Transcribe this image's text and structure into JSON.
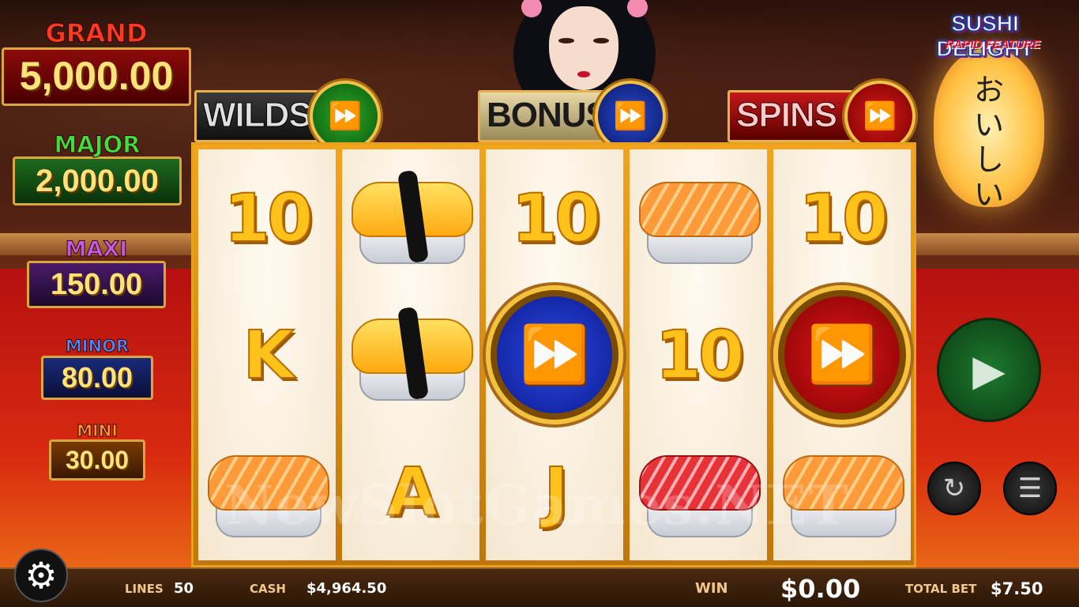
{
  "logo": {
    "title": "SUSHI DELIGHT",
    "subtitle": "RAPID FEATURE"
  },
  "jackpots": {
    "grand": {
      "label": "GRAND",
      "value": "5,000.00"
    },
    "major": {
      "label": "MAJOR",
      "value": "2,000.00"
    },
    "maxi": {
      "label": "MAXI",
      "value": "150.00"
    },
    "minor": {
      "label": "MINOR",
      "value": "80.00"
    },
    "mini": {
      "label": "MINI",
      "value": "30.00"
    }
  },
  "features": {
    "wilds": {
      "label": "WILDS"
    },
    "bonus": {
      "label": "BONUS"
    },
    "spins": {
      "label": "SPINS"
    }
  },
  "icons": {
    "fast_forward": "⏩",
    "spin": "▶",
    "autoplay": "↻",
    "coins": "☰",
    "settings": "⚙"
  },
  "reels": [
    [
      {
        "type": "number",
        "text": "10"
      },
      {
        "type": "letter",
        "text": "K"
      },
      {
        "type": "sushi",
        "variant": "salmon"
      }
    ],
    [
      {
        "type": "sushi",
        "variant": "tamago"
      },
      {
        "type": "sushi",
        "variant": "tamago"
      },
      {
        "type": "letter",
        "text": "A"
      }
    ],
    [
      {
        "type": "number",
        "text": "10"
      },
      {
        "type": "coin",
        "variant": "blue"
      },
      {
        "type": "letter",
        "text": "J"
      }
    ],
    [
      {
        "type": "sushi",
        "variant": "salmon"
      },
      {
        "type": "number",
        "text": "10"
      },
      {
        "type": "sushi",
        "variant": "tuna"
      }
    ],
    [
      {
        "type": "number",
        "text": "10"
      },
      {
        "type": "coin",
        "variant": "red"
      },
      {
        "type": "sushi",
        "variant": "salmon"
      }
    ]
  ],
  "watermark": "NewSlotGames.NET",
  "lantern_text": "おいしい",
  "bottom_bar": {
    "lines_label": "LINES",
    "lines_value": "50",
    "cash_label": "CASH",
    "cash_value": "$4,964.50",
    "win_label": "WIN",
    "win_value": "$0.00",
    "total_bet_label": "TOTAL BET",
    "total_bet_value": "$7.50"
  }
}
